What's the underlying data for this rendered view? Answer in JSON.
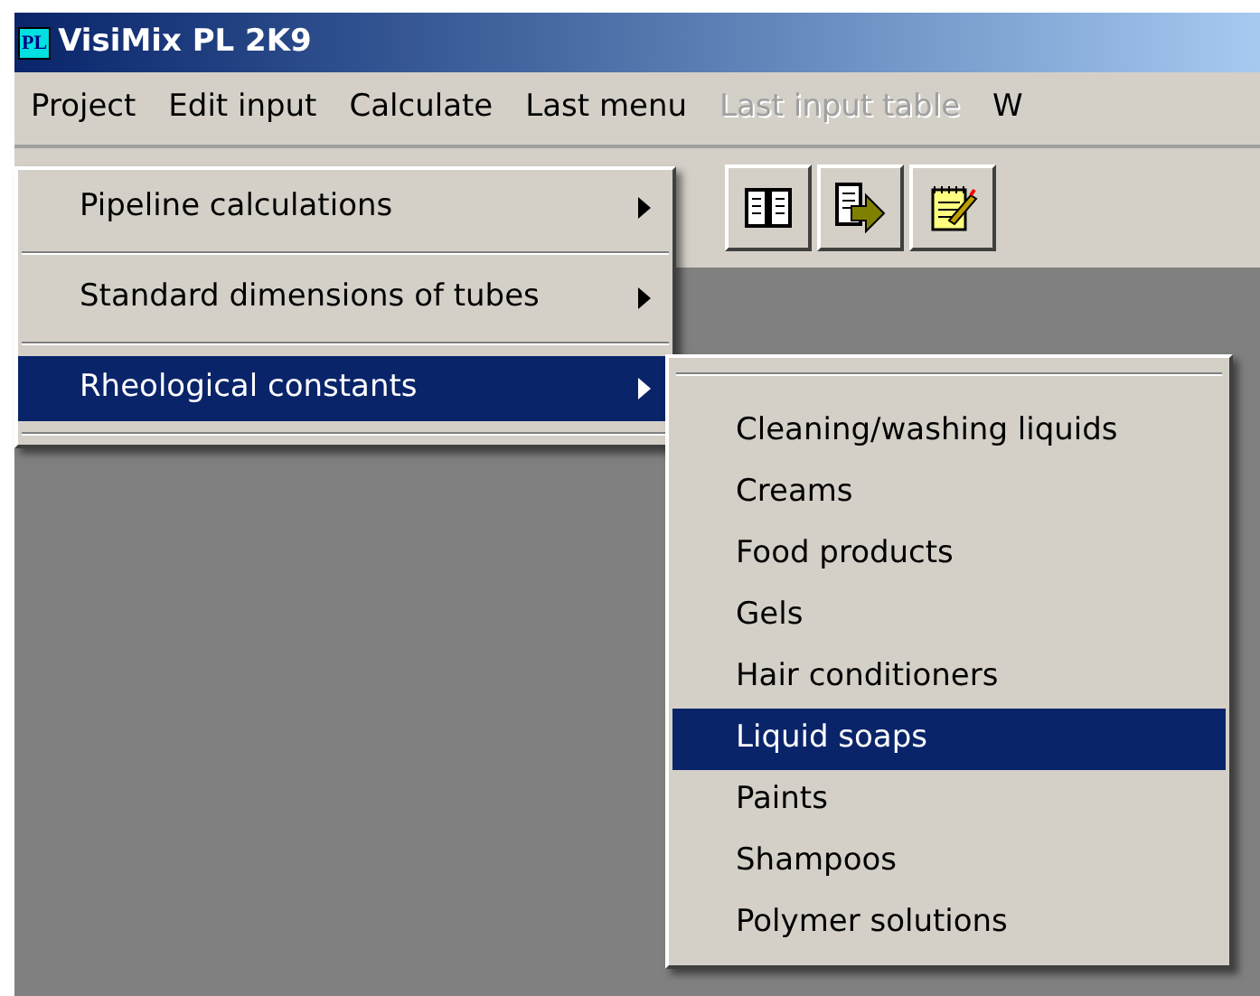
{
  "window": {
    "title": "VisiMix PL 2K9",
    "logo": "PL"
  },
  "menubar": [
    {
      "label": "Project",
      "disabled": false
    },
    {
      "label": "Edit input",
      "disabled": false
    },
    {
      "label": "Calculate",
      "disabled": false
    },
    {
      "label": "Last menu",
      "disabled": false
    },
    {
      "label": "Last input table",
      "disabled": true
    },
    {
      "label": "W",
      "disabled": false
    }
  ],
  "toolbar": [
    {
      "kind": "book"
    },
    {
      "kind": "export"
    },
    {
      "kind": "notepad"
    }
  ],
  "menu": [
    {
      "label": "Pipeline calculations",
      "selected": false
    },
    {
      "label": "Standard dimensions of tubes",
      "selected": false
    },
    {
      "label": "Rheological constants",
      "selected": true
    }
  ],
  "submenu": [
    {
      "label": "Cleaning/washing liquids",
      "selected": false
    },
    {
      "label": "Creams",
      "selected": false
    },
    {
      "label": "Food products",
      "selected": false
    },
    {
      "label": "Gels",
      "selected": false
    },
    {
      "label": "Hair conditioners",
      "selected": false
    },
    {
      "label": "Liquid soaps",
      "selected": true
    },
    {
      "label": "Paints",
      "selected": false
    },
    {
      "label": "Shampoos",
      "selected": false
    },
    {
      "label": "Polymer solutions",
      "selected": false
    }
  ]
}
